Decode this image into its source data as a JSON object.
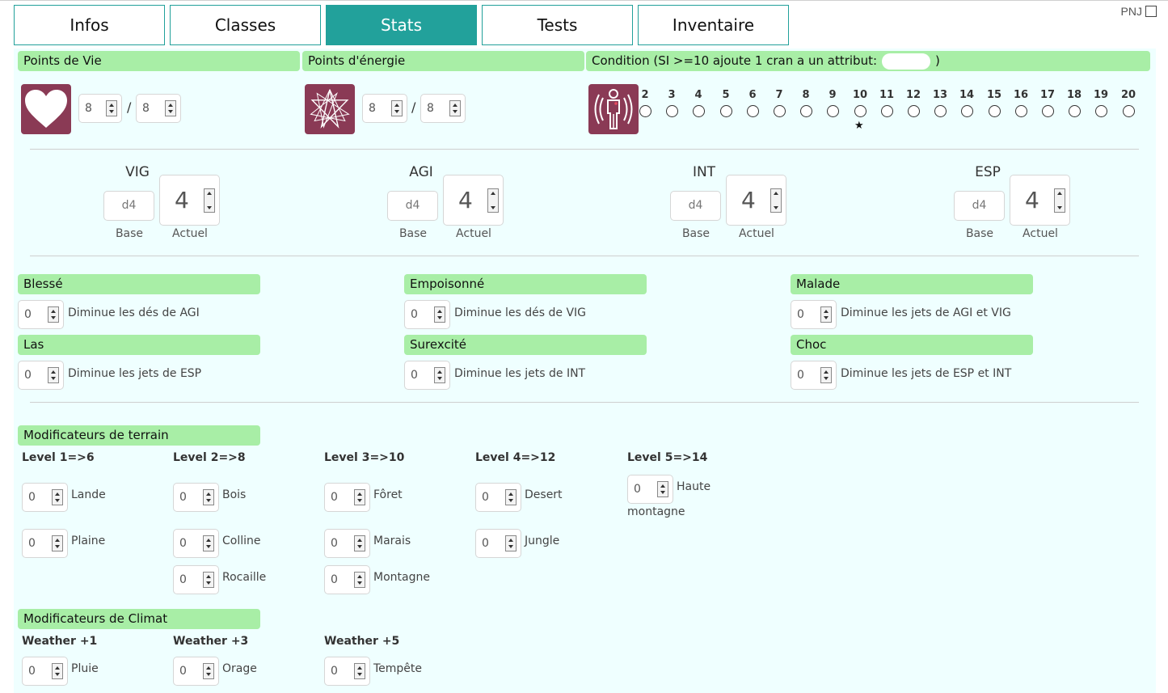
{
  "pnj": {
    "label": "PNJ"
  },
  "tabs": [
    {
      "label": "Infos"
    },
    {
      "label": "Classes"
    },
    {
      "label": "Stats"
    },
    {
      "label": "Tests"
    },
    {
      "label": "Inventaire"
    }
  ],
  "active_tab": "Stats",
  "headers": {
    "points_de_vie": "Points de Vie",
    "points_energie": "Points d'énergie",
    "condition_prefix": "Condition (SI >=10 ajoute 1 cran a un attribut:",
    "condition_suffix": ")"
  },
  "pv": {
    "current": "8",
    "max": "8",
    "separator": "/"
  },
  "pe": {
    "current": "8",
    "max": "8",
    "separator": "/"
  },
  "condition_scale": [
    "2",
    "3",
    "4",
    "5",
    "6",
    "7",
    "8",
    "9",
    "10",
    "11",
    "12",
    "13",
    "14",
    "15",
    "16",
    "17",
    "18",
    "19",
    "20"
  ],
  "condition_marker": {
    "value": "10",
    "glyph": "★"
  },
  "attributes": [
    {
      "name": "VIG",
      "base": "d4",
      "actuel": "4",
      "base_label": "Base",
      "actuel_label": "Actuel"
    },
    {
      "name": "AGI",
      "base": "d4",
      "actuel": "4",
      "base_label": "Base",
      "actuel_label": "Actuel"
    },
    {
      "name": "INT",
      "base": "d4",
      "actuel": "4",
      "base_label": "Base",
      "actuel_label": "Actuel"
    },
    {
      "name": "ESP",
      "base": "d4",
      "actuel": "4",
      "base_label": "Base",
      "actuel_label": "Actuel"
    }
  ],
  "states": [
    {
      "title": "Blessé",
      "value": "0",
      "desc": "Diminue les dés de AGI"
    },
    {
      "title": "Empoisonné",
      "value": "0",
      "desc": "Diminue les dés de VIG"
    },
    {
      "title": "Malade",
      "value": "0",
      "desc": "Diminue les jets de AGI et VIG"
    },
    {
      "title": "Las",
      "value": "0",
      "desc": "Diminue les jets de ESP"
    },
    {
      "title": "Surexcité",
      "value": "0",
      "desc": "Diminue les jets de INT"
    },
    {
      "title": "Choc",
      "value": "0",
      "desc": "Diminue les jets de ESP et INT"
    }
  ],
  "terrain": {
    "title": "Modificateurs de terrain",
    "levels": [
      {
        "label": "Level 1=>6",
        "items": [
          {
            "value": "0",
            "name": "Lande"
          },
          {
            "value": "0",
            "name": "Plaine"
          }
        ]
      },
      {
        "label": "Level 2=>8",
        "items": [
          {
            "value": "0",
            "name": "Bois"
          },
          {
            "value": "0",
            "name": "Colline"
          },
          {
            "value": "0",
            "name": "Rocaille"
          }
        ]
      },
      {
        "label": "Level 3=>10",
        "items": [
          {
            "value": "0",
            "name": "Fôret"
          },
          {
            "value": "0",
            "name": "Marais"
          },
          {
            "value": "0",
            "name": "Montagne"
          }
        ]
      },
      {
        "label": "Level 4=>12",
        "items": [
          {
            "value": "0",
            "name": "Desert"
          },
          {
            "value": "0",
            "name": "Jungle"
          }
        ]
      },
      {
        "label": "Level 5=>14",
        "items": [
          {
            "value": "0",
            "name": "Haute",
            "name2": "montagne"
          }
        ]
      }
    ]
  },
  "climat": {
    "title": "Modificateurs de Climat",
    "levels": [
      {
        "label": "Weather +1",
        "items": [
          {
            "value": "0",
            "name": "Pluie"
          }
        ]
      },
      {
        "label": "Weather +3",
        "items": [
          {
            "value": "0",
            "name": "Orage"
          }
        ]
      },
      {
        "label": "Weather +5",
        "items": [
          {
            "value": "0",
            "name": "Tempête"
          }
        ]
      }
    ]
  },
  "colors": {
    "accent": "#22a19b",
    "header_green": "#a8eea6",
    "panel_bg": "#efffff",
    "icon_bg": "#8a3a55"
  },
  "icons": [
    "heart-icon",
    "heptagram-icon",
    "body-scan-icon"
  ]
}
